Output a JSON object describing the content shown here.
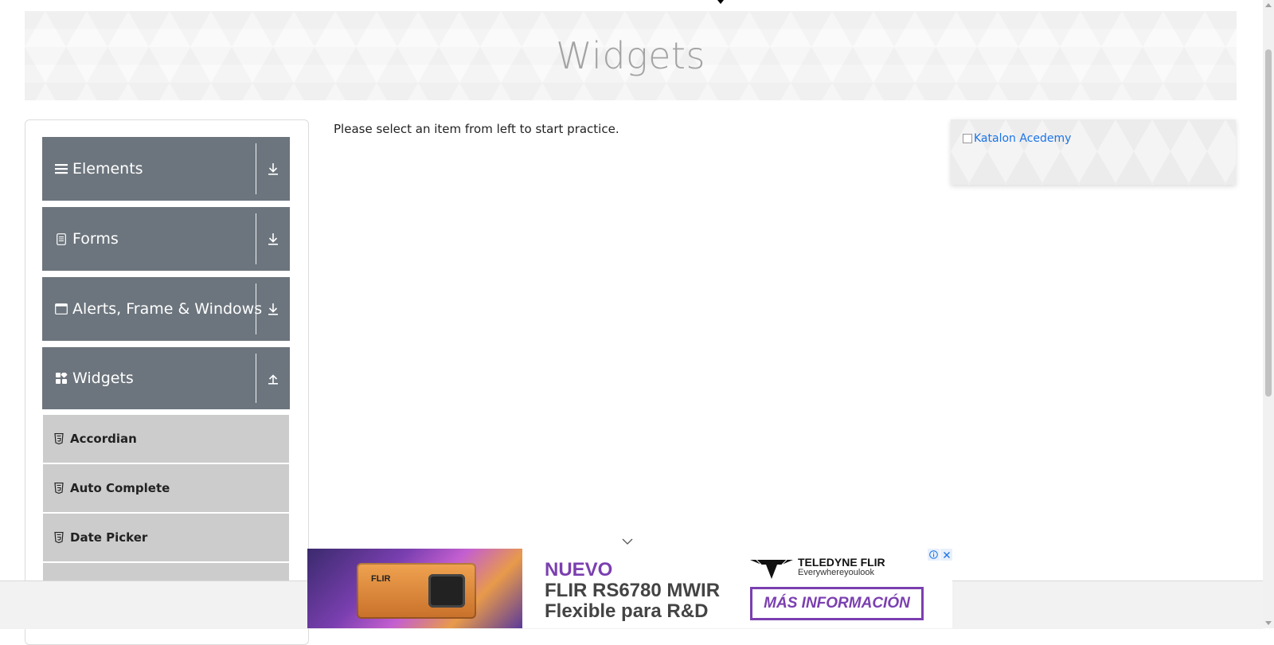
{
  "page": {
    "title": "Widgets",
    "instruction": "Please select an item from left to start practice."
  },
  "sidebar": {
    "groups": [
      {
        "label": "Elements",
        "icon": "hamburger-icon",
        "arrow": "download-arrow-icon",
        "expanded": false
      },
      {
        "label": "Forms",
        "icon": "document-icon",
        "arrow": "download-arrow-icon",
        "expanded": false
      },
      {
        "label": "Alerts, Frame & Windows",
        "icon": "window-icon",
        "arrow": "download-arrow-icon",
        "expanded": false
      },
      {
        "label": "Widgets",
        "icon": "widgets-icon",
        "arrow": "upload-arrow-icon",
        "expanded": true
      }
    ],
    "widget_items": [
      {
        "label": "Accordian",
        "icon": "html5-icon"
      },
      {
        "label": "Auto Complete",
        "icon": "html5-icon"
      },
      {
        "label": "Date Picker",
        "icon": "html5-icon"
      }
    ]
  },
  "right_ad": {
    "alt_text": "Katalon Acedemy"
  },
  "bottom_ad": {
    "camera_brand": "FLIR",
    "line1": "NUEVO",
    "line2": "FLIR RS6780 MWIR",
    "line3": "Flexible para R&D",
    "logo_brand": "TELEDYNE FLIR",
    "logo_tagline": "Everywhereyoulook",
    "cta": "MÁS INFORMACIÓN",
    "controls": [
      "info-icon",
      "close-icon"
    ]
  },
  "colors": {
    "sidebar_header": "#6c757d",
    "menu_item": "#cccccc",
    "ad_accent": "#7b3fb0",
    "link": "#1a73e8"
  }
}
